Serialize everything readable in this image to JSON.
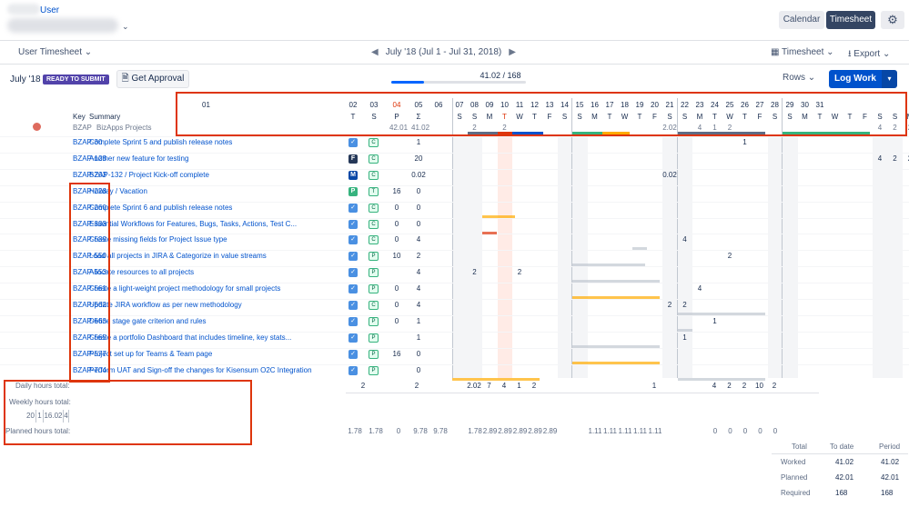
{
  "header": {
    "user_link": "User",
    "view_calendar": "Calendar",
    "view_timesheet": "Timesheet",
    "settings_icon": "gear-icon"
  },
  "subbar": {
    "user_timesheet": "User Timesheet",
    "period_label": "July '18 (Jul 1 - Jul 31, 2018)",
    "timesheet_dd": "Timesheet",
    "export_dd": "Export"
  },
  "toolbar": {
    "month": "July '18",
    "status_badge": "READY TO SUBMIT",
    "get_approval": "Get Approval",
    "progress_text": "41.02 / 168",
    "progress_fraction": 0.244,
    "rows_dd": "Rows",
    "log_work": "Log Work"
  },
  "grid": {
    "col_headers": {
      "key": "Key",
      "summary": "Summary",
      "first_day": "01"
    },
    "stat_headers": [
      {
        "day": "02",
        "label": "T"
      },
      {
        "day": "03",
        "label": "S"
      },
      {
        "day": "04",
        "label": "P"
      },
      {
        "day": "05",
        "label": "Σ"
      },
      {
        "day": "06",
        "label": ""
      }
    ],
    "days": [
      {
        "d": "07",
        "w": "S"
      },
      {
        "d": "08",
        "w": "S"
      },
      {
        "d": "09",
        "w": "M"
      },
      {
        "d": "10",
        "w": "T"
      },
      {
        "d": "11",
        "w": "W"
      },
      {
        "d": "12",
        "w": "T"
      },
      {
        "d": "13",
        "w": "F"
      },
      {
        "d": "14",
        "w": "S"
      },
      {
        "d": "15",
        "w": "S"
      },
      {
        "d": "16",
        "w": "M"
      },
      {
        "d": "17",
        "w": "T"
      },
      {
        "d": "18",
        "w": "W"
      },
      {
        "d": "19",
        "w": "T"
      },
      {
        "d": "20",
        "w": "F"
      },
      {
        "d": "21",
        "w": "S"
      },
      {
        "d": "22",
        "w": "S"
      },
      {
        "d": "23",
        "w": "M"
      },
      {
        "d": "24",
        "w": "T"
      },
      {
        "d": "25",
        "w": "W"
      },
      {
        "d": "26",
        "w": "T"
      },
      {
        "d": "27",
        "w": "F"
      },
      {
        "d": "28",
        "w": "S"
      },
      {
        "d": "29",
        "w": "S"
      },
      {
        "d": "30",
        "w": "M"
      },
      {
        "d": "31",
        "w": "T"
      },
      {
        "d": "",
        "w": "W"
      },
      {
        "d": "",
        "w": "T"
      },
      {
        "d": "",
        "w": "F"
      },
      {
        "d": "",
        "w": "S"
      },
      {
        "d": "",
        "w": "S"
      },
      {
        "d": "",
        "w": "M"
      },
      {
        "d": "",
        "w": "T"
      }
    ],
    "project_row": {
      "key": "BZAP",
      "summary": "BizApps Projects",
      "p": "42.01",
      "sum": "41.02",
      "cells": {
        "2": "2",
        "4": "2",
        "15": "2.02",
        "17": "4",
        "18": "1",
        "19": "2",
        "29": "4",
        "30": "2",
        "31": "2",
        "32": "10",
        "33": "2"
      }
    },
    "rows": [
      {
        "key": "BZAP-30",
        "summary": "Complete Sprint 5 and publish release notes",
        "icon": "check",
        "letter": "C",
        "p": "",
        "sum": "1",
        "cells": {
          "20": "1"
        }
      },
      {
        "key": "BZAP-128",
        "summary": "Another new feature for testing",
        "icon": "F",
        "letter": "C",
        "p": "",
        "sum": "20",
        "cells": {
          "29": "4",
          "30": "2",
          "31": "2",
          "32": "10",
          "33": "2"
        }
      },
      {
        "key": "BZAP-203",
        "summary": "BZAP-132 / Project Kick-off complete",
        "icon": "M",
        "letter": "C",
        "p": "",
        "sum": "0.02",
        "cells": {
          "15": "0.02"
        }
      },
      {
        "key": "BZAP-228",
        "summary": "Holiday / Vacation",
        "icon": "P",
        "letter": "T",
        "p": "16",
        "sum": "0",
        "cells": {}
      },
      {
        "key": "BZAP-260",
        "summary": "Complete Sprint 6 and publish release notes",
        "icon": "check",
        "letter": "C",
        "p": "0",
        "sum": "0",
        "cells": {}
      },
      {
        "key": "BZAP-333",
        "summary": "Essential Workflows for Features, Bugs, Tasks, Actions, Test C...",
        "icon": "check",
        "letter": "C",
        "p": "0",
        "sum": "0",
        "cells": {}
      },
      {
        "key": "BZAP-539",
        "summary": "Create missing fields for Project Issue type",
        "icon": "check",
        "letter": "C",
        "p": "0",
        "sum": "4",
        "cells": {
          "16": "4"
        }
      },
      {
        "key": "BZAP-550",
        "summary": "Load all projects in JIRA & Categorize in value streams",
        "icon": "check",
        "letter": "P",
        "p": "10",
        "sum": "2",
        "cells": {
          "19": "2"
        }
      },
      {
        "key": "BZAP-553",
        "summary": "Allocate resources to all projects",
        "icon": "check",
        "letter": "P",
        "p": "",
        "sum": "4",
        "cells": {
          "2": "2",
          "5": "2"
        }
      },
      {
        "key": "BZAP-561",
        "summary": "Create a light-weight project methodology for small projects",
        "icon": "check",
        "letter": "P",
        "p": "0",
        "sum": "4",
        "cells": {
          "17": "4"
        }
      },
      {
        "key": "BZAP-562",
        "summary": "Update JIRA workflow as per new methodology",
        "icon": "check",
        "letter": "C",
        "p": "0",
        "sum": "4",
        "cells": {
          "15": "2",
          "16": "2"
        }
      },
      {
        "key": "BZAP-563",
        "summary": "Define stage gate criterion and rules",
        "icon": "check",
        "letter": "P",
        "p": "0",
        "sum": "1",
        "cells": {
          "18": "1"
        }
      },
      {
        "key": "BZAP-565",
        "summary": "Create a portfolio Dashboard that includes timeline, key stats...",
        "icon": "check",
        "letter": "P",
        "p": "",
        "sum": "1",
        "cells": {
          "16": "1"
        }
      },
      {
        "key": "BZAP-577",
        "summary": "Project set up for Teams & Team page",
        "icon": "check",
        "letter": "P",
        "p": "16",
        "sum": "0",
        "cells": {}
      },
      {
        "key": "BZAP-704",
        "summary": "Perform UAT and Sign-off the changes for Kisensum O2C Integration",
        "icon": "check",
        "letter": "P",
        "p": "",
        "sum": "0",
        "cells": {}
      }
    ]
  },
  "footer": {
    "daily_label": "Daily hours total:",
    "weekly_label": "Weekly hours total:",
    "planned_label": "Planned hours total:",
    "daily_stats": {
      "T": "2",
      "P": "2"
    },
    "daily_cells": {
      "0": "2.02",
      "1": "7",
      "2": "4",
      "3": "1",
      "4": "2",
      "12": "1",
      "16": "4",
      "17": "2",
      "18": "2",
      "19": "10",
      "20": "2"
    },
    "weekly_values": [
      "20",
      "1",
      "16.02",
      "4"
    ],
    "planned_stats": {
      "T": "1.78",
      "S": "1.78",
      "P": "0",
      "sum": "9.78",
      "d06": "9.78"
    },
    "planned_cells": {
      "0": "1.78",
      "1": "2.89",
      "2": "2.89",
      "3": "2.89",
      "4": "2.89",
      "5": "2.89",
      "8": "1.11",
      "9": "1.11",
      "10": "1.11",
      "11": "1.11",
      "12": "1.11",
      "16": "0",
      "17": "0",
      "18": "0",
      "19": "0",
      "20": "0"
    }
  },
  "summary_table": {
    "headers": [
      "Total",
      "To date",
      "Period"
    ],
    "rows": [
      {
        "label": "Worked",
        "to_date": "41.02",
        "period": "41.02"
      },
      {
        "label": "Planned",
        "to_date": "42.01",
        "period": "42.01"
      },
      {
        "label": "Required",
        "to_date": "168",
        "period": "168"
      }
    ]
  },
  "colors": {
    "accent": "#0052cc",
    "highlight": "#de350b",
    "weekend": "#f4f5f7",
    "today": "#ffebe6"
  }
}
